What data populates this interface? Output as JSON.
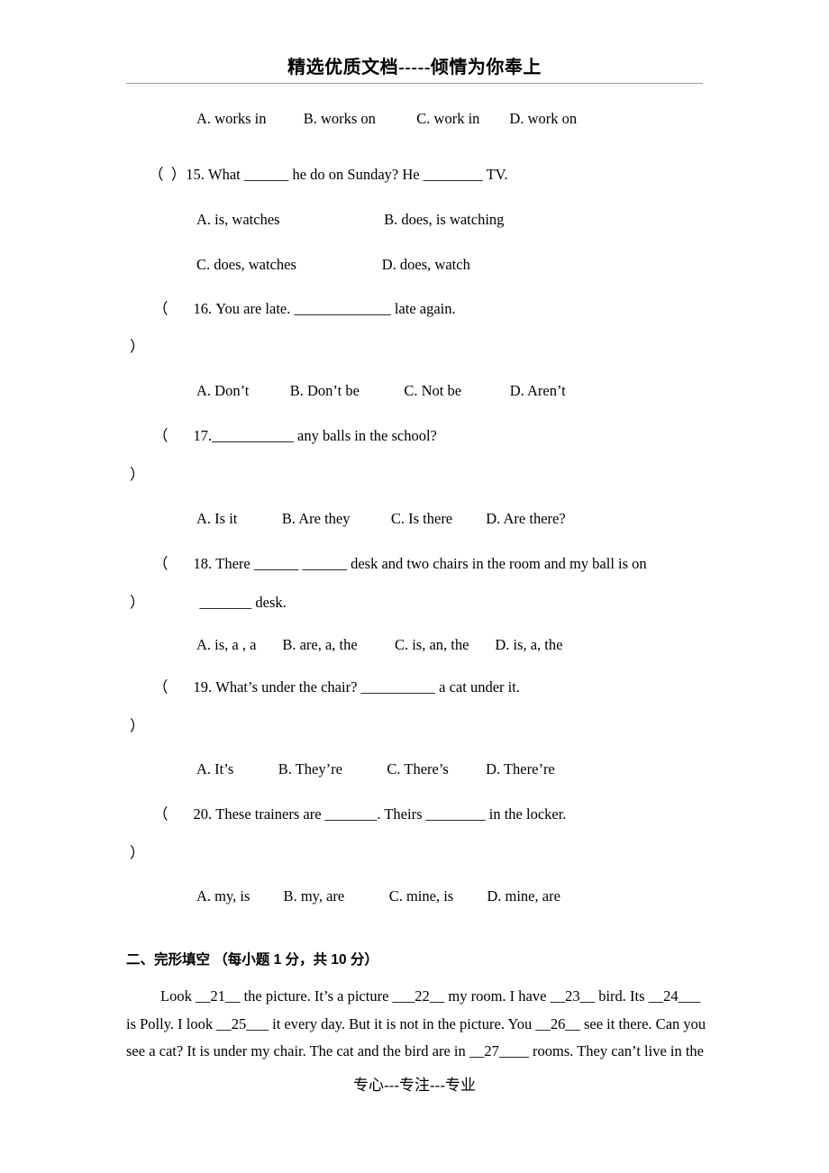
{
  "header": {
    "banner": "精选优质文档-----倾情为你奉上"
  },
  "footer": {
    "text": "专心---专注---专业"
  },
  "questions": [
    {
      "id": "q14-options",
      "marker": "",
      "stem": "",
      "options_line": "A. works in          B. works on           C. work in        D. work on"
    },
    {
      "id": "q15",
      "marker": "（  ）",
      "stem": "15. What ______ he do on Sunday? He ________ TV.",
      "opt_line_1": "A. is, watches                            B. does, is watching",
      "opt_line_2": "C. does, watches                       D. does, watch"
    },
    {
      "id": "q16",
      "marker_open": "（",
      "marker_close": "）",
      "stem": "16. You are late. _____________ late again.",
      "options_line": "A. Don’t           B. Don’t be            C. Not be             D. Aren’t"
    },
    {
      "id": "q17",
      "marker_open": "（",
      "marker_close": "）",
      "stem": "17.___________ any balls in the school?",
      "options_line": "A. Is it            B. Are they           C. Is there         D. Are there?"
    },
    {
      "id": "q18",
      "marker_open": "（",
      "marker_close": "）",
      "stem": "18. There ______ ______ desk and two chairs in the room and my ball is on",
      "stem2": "_______ desk.",
      "options_line": "A. is, a , a       B. are, a, the          C. is, an, the       D. is, a, the"
    },
    {
      "id": "q19",
      "marker_open": "（",
      "marker_close": "）",
      "stem": "19. What’s under the chair? __________ a cat under it.",
      "options_line": "A. It’s            B. They’re            C. There’s          D. There’re"
    },
    {
      "id": "q20",
      "marker_open": "（",
      "marker_close": "）",
      "stem": "20. These trainers are _______. Theirs ________ in the locker.",
      "options_line": "A. my, is         B. my, are            C. mine, is         D. mine, are"
    }
  ],
  "section2": {
    "heading": "二、完形填空 （每小题 1 分，共 10 分）",
    "passage_line_1": "Look __21__ the picture. It’s a picture ___22__ my room. I have __23__ bird. Its __24___",
    "passage_line_2": "is Polly. I look __25___ it every day. But it is not in the picture. You __26__ see it there. Can you",
    "passage_line_3": "see a cat? It is under my chair. The cat and the bird are in __27____ rooms. They can’t live in the"
  }
}
